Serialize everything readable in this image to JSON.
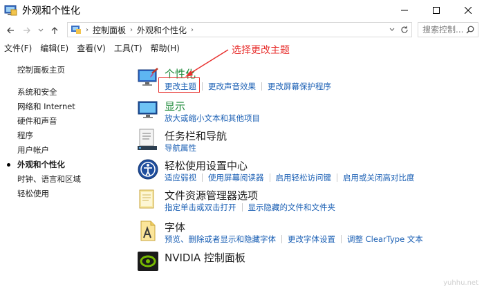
{
  "window": {
    "title": "外观和个性化"
  },
  "navigation": {
    "breadcrumbs": [
      "控制面板",
      "外观和个性化"
    ],
    "search_placeholder": "搜索控制..."
  },
  "menubar": {
    "items": [
      "文件(F)",
      "编辑(E)",
      "查看(V)",
      "工具(T)",
      "帮助(H)"
    ]
  },
  "sidebar": {
    "home": "控制面板主页",
    "items": [
      {
        "label": "系统和安全"
      },
      {
        "label": "网络和 Internet"
      },
      {
        "label": "硬件和声音"
      },
      {
        "label": "程序"
      },
      {
        "label": "用户帐户"
      },
      {
        "label": "外观和个性化",
        "active": true
      },
      {
        "label": "时钟、语言和区域"
      },
      {
        "label": "轻松使用"
      }
    ]
  },
  "categories": {
    "personalization": {
      "title": "个性化",
      "icon": "personalization-icon",
      "links": [
        "更改主题",
        "更改声音效果",
        "更改屏幕保护程序"
      ]
    },
    "display": {
      "title": "显示",
      "icon": "display-icon",
      "links": [
        "放大或缩小文本和其他项目"
      ]
    },
    "taskbar": {
      "title": "任务栏和导航",
      "icon": "taskbar-icon",
      "links": [
        "导航属性"
      ]
    },
    "ease": {
      "title": "轻松使用设置中心",
      "icon": "ease-of-access-icon",
      "links": [
        "适应弱视",
        "使用屏幕阅读器",
        "启用轻松访问键",
        "启用或关闭高对比度"
      ]
    },
    "explorer": {
      "title": "文件资源管理器选项",
      "icon": "folder-options-icon",
      "links": [
        "指定单击或双击打开",
        "显示隐藏的文件和文件夹"
      ]
    },
    "fonts": {
      "title": "字体",
      "icon": "fonts-icon",
      "links": [
        "预览、删除或者显示和隐藏字体",
        "更改字体设置",
        "调整 ClearType 文本"
      ]
    },
    "nvidia": {
      "title": "NVIDIA 控制面板",
      "icon": "nvidia-icon"
    }
  },
  "annotation": {
    "text": "选择更改主题",
    "color": "#e8312f"
  },
  "watermark": "yuhhu.net",
  "colors": {
    "link": "#1a5fb4",
    "category_title": "#1e8a3a",
    "annotation": "#e8312f"
  }
}
